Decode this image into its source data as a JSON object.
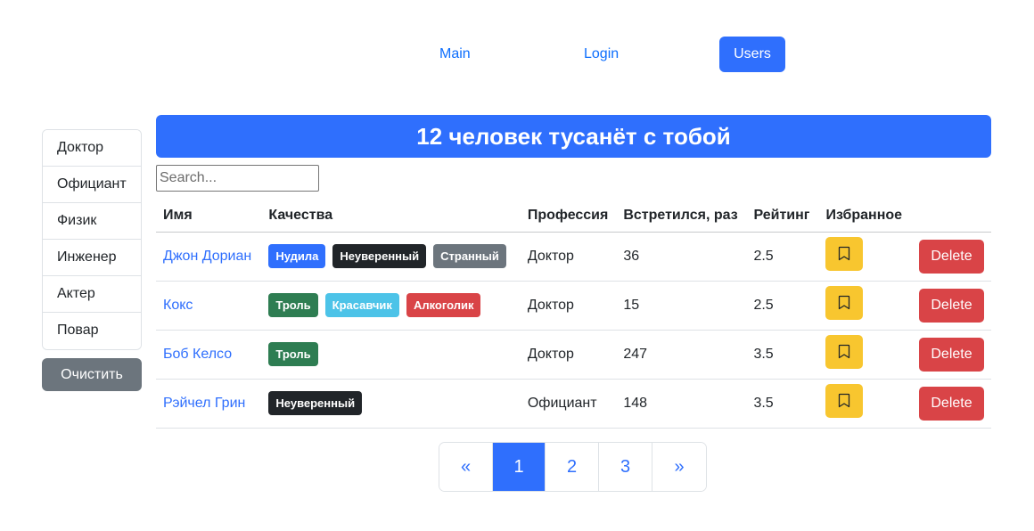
{
  "nav": {
    "items": [
      {
        "label": "Main"
      },
      {
        "label": "Login"
      },
      {
        "label": "Users"
      }
    ],
    "active": "Users"
  },
  "sidebar": {
    "items": [
      {
        "label": "Доктор"
      },
      {
        "label": "Официант"
      },
      {
        "label": "Физик"
      },
      {
        "label": "Инженер"
      },
      {
        "label": "Актер"
      },
      {
        "label": "Повар"
      }
    ],
    "clear_label": "Очистить"
  },
  "banner": {
    "title": "12 человек тусанёт с тобой"
  },
  "search": {
    "placeholder": "Search...",
    "value": ""
  },
  "table": {
    "headers": {
      "name": "Имя",
      "qualities": "Качества",
      "profession": "Профессия",
      "met": "Встретился, раз",
      "rating": "Рейтинг",
      "favorite": "Избранное"
    },
    "rows": [
      {
        "name": "Джон Дориан",
        "qualities": [
          {
            "label": "Нудила",
            "color": "#2f6ffd"
          },
          {
            "label": "Неуверенный",
            "color": "#212529"
          },
          {
            "label": "Странный",
            "color": "#6c757d"
          }
        ],
        "profession": "Доктор",
        "met": "36",
        "rating": "2.5",
        "delete_label": "Delete"
      },
      {
        "name": "Кокс",
        "qualities": [
          {
            "label": "Троль",
            "color": "#2e7d52"
          },
          {
            "label": "Красавчик",
            "color": "#4cc3e8"
          },
          {
            "label": "Алкоголик",
            "color": "#d94447"
          }
        ],
        "profession": "Доктор",
        "met": "15",
        "rating": "2.5",
        "delete_label": "Delete"
      },
      {
        "name": "Боб Келсо",
        "qualities": [
          {
            "label": "Троль",
            "color": "#2e7d52"
          }
        ],
        "profession": "Доктор",
        "met": "247",
        "rating": "3.5",
        "delete_label": "Delete"
      },
      {
        "name": "Рэйчел Грин",
        "qualities": [
          {
            "label": "Неуверенный",
            "color": "#212529"
          }
        ],
        "profession": "Официант",
        "met": "148",
        "rating": "3.5",
        "delete_label": "Delete"
      }
    ]
  },
  "pagination": {
    "prev": "«",
    "pages": [
      "1",
      "2",
      "3"
    ],
    "next": "»",
    "current": "1"
  },
  "colors": {
    "primary": "#2f6ffd",
    "danger": "#d94447",
    "warning": "#f8c62f",
    "secondary": "#6c757d"
  },
  "icons": {
    "favorite": "bookmark-icon"
  }
}
